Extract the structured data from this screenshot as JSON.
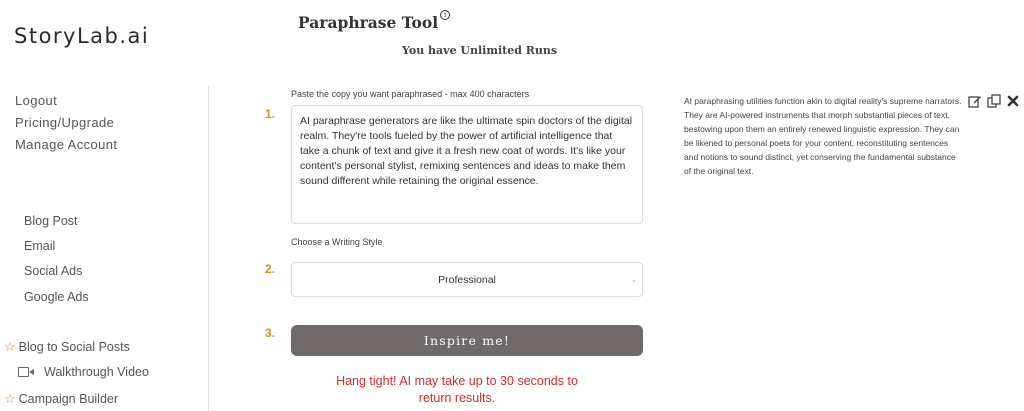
{
  "brand": "StoryLab.ai",
  "account_links": [
    {
      "label": "Logout"
    },
    {
      "label": "Pricing/Upgrade"
    },
    {
      "label": "Manage Account"
    }
  ],
  "nav_links": [
    {
      "label": "Blog Post"
    },
    {
      "label": "Email"
    },
    {
      "label": "Social Ads"
    },
    {
      "label": "Google Ads"
    }
  ],
  "favorites": [
    {
      "label": "Blog to Social Posts",
      "icon": "star-icon"
    },
    {
      "label": "Walkthrough Video",
      "icon": "video-camera-icon"
    },
    {
      "label": "Campaign Builder",
      "icon": "star-icon"
    }
  ],
  "tool": {
    "title": "Paraphrase Tool",
    "info_icon": "info-icon",
    "runs": "You have Unlimited Runs"
  },
  "steps": {
    "one": "1.",
    "two": "2.",
    "three": "3."
  },
  "input": {
    "label": "Paste the copy you want paraphrased - max 400 characters",
    "value": "AI paraphrase generators are like the ultimate spin doctors of the digital realm. They're tools fueled by the power of artificial intelligence that take a chunk of text and give it a fresh new coat of words. It's like your content's personal stylist, remixing sentences and ideas to make them sound different while retaining the original essence."
  },
  "style": {
    "label": "Choose a Writing Style",
    "selected": "Professional"
  },
  "actions": {
    "inspire": "Inspire me!",
    "wait_message": "Hang tight! AI may take up to 30 seconds to return results."
  },
  "output": {
    "text": "AI paraphrasing utilities function akin to digital reality's supreme narrators. They are AI-powered instruments that morph substantial pieces of text, bestowing upon them an entirely renewed linguistic expression. They can be likened to personal poets for your content, reconstituting sentences and notions to sound distinct, yet conserving the fundamental substance of the original text.",
    "tools": [
      "edit-icon",
      "copy-icon",
      "close-icon"
    ]
  },
  "colors": {
    "accent": "#e08a1e",
    "button": "#6f6a69",
    "warning": "#d42a2a"
  }
}
